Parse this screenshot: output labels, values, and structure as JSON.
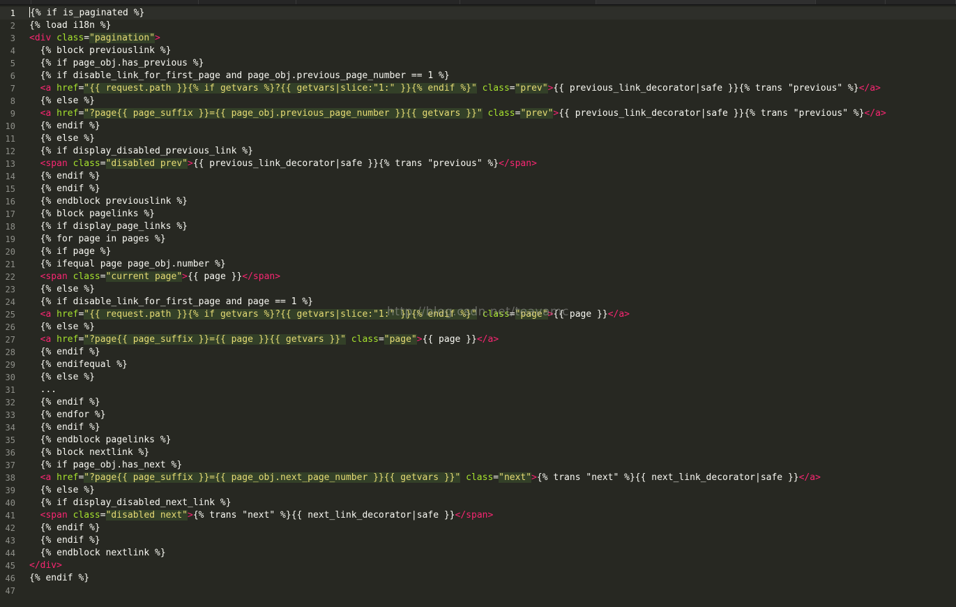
{
  "editor": {
    "colors": {
      "background": "#272822",
      "text": "#f8f8f2",
      "tag": "#f92672",
      "attribute": "#a6e22e",
      "string": "#e6db74",
      "line_number": "#8f908a"
    },
    "watermark": "http://blog.csdn.net/teavamc",
    "lines": [
      {
        "n": "1",
        "parts": [
          [
            "t",
            "{% if is_paginated %}"
          ]
        ]
      },
      {
        "n": "2",
        "parts": [
          [
            "t",
            "{% load i18n %}"
          ]
        ]
      },
      {
        "n": "3",
        "parts": [
          [
            "g",
            "<div"
          ],
          [
            "t",
            " "
          ],
          [
            "a",
            "class"
          ],
          [
            "t",
            "="
          ],
          [
            "s",
            "\"pagination\""
          ],
          [
            "g",
            ">"
          ]
        ]
      },
      {
        "n": "4",
        "parts": [
          [
            "t",
            "  {% block previouslink %}"
          ]
        ]
      },
      {
        "n": "5",
        "parts": [
          [
            "t",
            "  {% if page_obj.has_previous %}"
          ]
        ]
      },
      {
        "n": "6",
        "parts": [
          [
            "t",
            "  {% if disable_link_for_first_page and page_obj.previous_page_number == 1 %}"
          ]
        ]
      },
      {
        "n": "7",
        "parts": [
          [
            "t",
            "  "
          ],
          [
            "g",
            "<a"
          ],
          [
            "t",
            " "
          ],
          [
            "a",
            "href"
          ],
          [
            "t",
            "="
          ],
          [
            "s",
            "\"{{ request.path }}{% if getvars %}?{{ getvars|slice:\"1:\" }}{% endif %}\""
          ],
          [
            "t",
            " "
          ],
          [
            "a",
            "class"
          ],
          [
            "t",
            "="
          ],
          [
            "s",
            "\"prev\""
          ],
          [
            "g",
            ">"
          ],
          [
            "t",
            "{{ previous_link_decorator|safe }}{% trans \"previous\" %}"
          ],
          [
            "g",
            "</a>"
          ]
        ]
      },
      {
        "n": "8",
        "parts": [
          [
            "t",
            "  {% else %}"
          ]
        ]
      },
      {
        "n": "9",
        "parts": [
          [
            "t",
            "  "
          ],
          [
            "g",
            "<a"
          ],
          [
            "t",
            " "
          ],
          [
            "a",
            "href"
          ],
          [
            "t",
            "="
          ],
          [
            "s",
            "\"?page{{ page_suffix }}={{ page_obj.previous_page_number }}{{ getvars }}\""
          ],
          [
            "t",
            " "
          ],
          [
            "a",
            "class"
          ],
          [
            "t",
            "="
          ],
          [
            "s",
            "\"prev\""
          ],
          [
            "g",
            ">"
          ],
          [
            "t",
            "{{ previous_link_decorator|safe }}{% trans \"previous\" %}"
          ],
          [
            "g",
            "</a>"
          ]
        ]
      },
      {
        "n": "10",
        "parts": [
          [
            "t",
            "  {% endif %}"
          ]
        ]
      },
      {
        "n": "11",
        "parts": [
          [
            "t",
            "  {% else %}"
          ]
        ]
      },
      {
        "n": "12",
        "parts": [
          [
            "t",
            "  {% if display_disabled_previous_link %}"
          ]
        ]
      },
      {
        "n": "13",
        "parts": [
          [
            "t",
            "  "
          ],
          [
            "g",
            "<span"
          ],
          [
            "t",
            " "
          ],
          [
            "a",
            "class"
          ],
          [
            "t",
            "="
          ],
          [
            "s",
            "\"disabled prev\""
          ],
          [
            "g",
            ">"
          ],
          [
            "t",
            "{{ previous_link_decorator|safe }}{% trans \"previous\" %}"
          ],
          [
            "g",
            "</span>"
          ]
        ]
      },
      {
        "n": "14",
        "parts": [
          [
            "t",
            "  {% endif %}"
          ]
        ]
      },
      {
        "n": "15",
        "parts": [
          [
            "t",
            "  {% endif %}"
          ]
        ]
      },
      {
        "n": "16",
        "parts": [
          [
            "t",
            "  {% endblock previouslink %}"
          ]
        ]
      },
      {
        "n": "17",
        "parts": [
          [
            "t",
            "  {% block pagelinks %}"
          ]
        ]
      },
      {
        "n": "18",
        "parts": [
          [
            "t",
            "  {% if display_page_links %}"
          ]
        ]
      },
      {
        "n": "19",
        "parts": [
          [
            "t",
            "  {% for page in pages %}"
          ]
        ]
      },
      {
        "n": "20",
        "parts": [
          [
            "t",
            "  {% if page %}"
          ]
        ]
      },
      {
        "n": "21",
        "parts": [
          [
            "t",
            "  {% ifequal page page_obj.number %}"
          ]
        ]
      },
      {
        "n": "22",
        "parts": [
          [
            "t",
            "  "
          ],
          [
            "g",
            "<span"
          ],
          [
            "t",
            " "
          ],
          [
            "a",
            "class"
          ],
          [
            "t",
            "="
          ],
          [
            "s",
            "\"current page\""
          ],
          [
            "g",
            ">"
          ],
          [
            "t",
            "{{ page }}"
          ],
          [
            "g",
            "</span>"
          ]
        ]
      },
      {
        "n": "23",
        "parts": [
          [
            "t",
            "  {% else %}"
          ]
        ]
      },
      {
        "n": "24",
        "parts": [
          [
            "t",
            "  {% if disable_link_for_first_page and page == 1 %}"
          ]
        ]
      },
      {
        "n": "25",
        "parts": [
          [
            "t",
            "  "
          ],
          [
            "g",
            "<a"
          ],
          [
            "t",
            " "
          ],
          [
            "a",
            "href"
          ],
          [
            "t",
            "="
          ],
          [
            "s",
            "\"{{ request.path }}{% if getvars %}?{{ getvars|slice:\"1:\" }}{% endif %}\""
          ],
          [
            "t",
            " "
          ],
          [
            "a",
            "class"
          ],
          [
            "t",
            "="
          ],
          [
            "s",
            "\"page\""
          ],
          [
            "g",
            ">"
          ],
          [
            "t",
            "{{ page }}"
          ],
          [
            "g",
            "</a>"
          ]
        ]
      },
      {
        "n": "26",
        "parts": [
          [
            "t",
            "  {% else %}"
          ]
        ]
      },
      {
        "n": "27",
        "parts": [
          [
            "t",
            "  "
          ],
          [
            "g",
            "<a"
          ],
          [
            "t",
            " "
          ],
          [
            "a",
            "href"
          ],
          [
            "t",
            "="
          ],
          [
            "s",
            "\"?page{{ page_suffix }}={{ page }}{{ getvars }}\""
          ],
          [
            "t",
            " "
          ],
          [
            "a",
            "class"
          ],
          [
            "t",
            "="
          ],
          [
            "s",
            "\"page\""
          ],
          [
            "g",
            ">"
          ],
          [
            "t",
            "{{ page }}"
          ],
          [
            "g",
            "</a>"
          ]
        ]
      },
      {
        "n": "28",
        "parts": [
          [
            "t",
            "  {% endif %}"
          ]
        ]
      },
      {
        "n": "29",
        "parts": [
          [
            "t",
            "  {% endifequal %}"
          ]
        ]
      },
      {
        "n": "30",
        "parts": [
          [
            "t",
            "  {% else %}"
          ]
        ]
      },
      {
        "n": "31",
        "parts": [
          [
            "t",
            "  ..."
          ]
        ]
      },
      {
        "n": "32",
        "parts": [
          [
            "t",
            "  {% endif %}"
          ]
        ]
      },
      {
        "n": "33",
        "parts": [
          [
            "t",
            "  {% endfor %}"
          ]
        ]
      },
      {
        "n": "34",
        "parts": [
          [
            "t",
            "  {% endif %}"
          ]
        ]
      },
      {
        "n": "35",
        "parts": [
          [
            "t",
            "  {% endblock pagelinks %}"
          ]
        ]
      },
      {
        "n": "36",
        "parts": [
          [
            "t",
            "  {% block nextlink %}"
          ]
        ]
      },
      {
        "n": "37",
        "parts": [
          [
            "t",
            "  {% if page_obj.has_next %}"
          ]
        ]
      },
      {
        "n": "38",
        "parts": [
          [
            "t",
            "  "
          ],
          [
            "g",
            "<a"
          ],
          [
            "t",
            " "
          ],
          [
            "a",
            "href"
          ],
          [
            "t",
            "="
          ],
          [
            "s",
            "\"?page{{ page_suffix }}={{ page_obj.next_page_number }}{{ getvars }}\""
          ],
          [
            "t",
            " "
          ],
          [
            "a",
            "class"
          ],
          [
            "t",
            "="
          ],
          [
            "s",
            "\"next\""
          ],
          [
            "g",
            ">"
          ],
          [
            "t",
            "{% trans \"next\" %}{{ next_link_decorator|safe }}"
          ],
          [
            "g",
            "</a>"
          ]
        ]
      },
      {
        "n": "39",
        "parts": [
          [
            "t",
            "  {% else %}"
          ]
        ]
      },
      {
        "n": "40",
        "parts": [
          [
            "t",
            "  {% if display_disabled_next_link %}"
          ]
        ]
      },
      {
        "n": "41",
        "parts": [
          [
            "t",
            "  "
          ],
          [
            "g",
            "<span"
          ],
          [
            "t",
            " "
          ],
          [
            "a",
            "class"
          ],
          [
            "t",
            "="
          ],
          [
            "s",
            "\"disabled next\""
          ],
          [
            "g",
            ">"
          ],
          [
            "t",
            "{% trans \"next\" %}{{ next_link_decorator|safe }}"
          ],
          [
            "g",
            "</span>"
          ]
        ]
      },
      {
        "n": "42",
        "parts": [
          [
            "t",
            "  {% endif %}"
          ]
        ]
      },
      {
        "n": "43",
        "parts": [
          [
            "t",
            "  {% endif %}"
          ]
        ]
      },
      {
        "n": "44",
        "parts": [
          [
            "t",
            "  {% endblock nextlink %}"
          ]
        ]
      },
      {
        "n": "45",
        "parts": [
          [
            "g",
            "</div>"
          ]
        ]
      },
      {
        "n": "46",
        "parts": [
          [
            "t",
            "{% endif %}"
          ]
        ]
      },
      {
        "n": "47",
        "parts": [
          [
            "t",
            ""
          ]
        ]
      }
    ]
  }
}
